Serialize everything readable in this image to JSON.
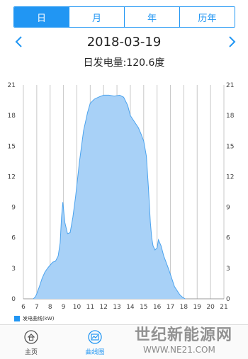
{
  "tabs": [
    {
      "label": "日",
      "active": true
    },
    {
      "label": "月",
      "active": false
    },
    {
      "label": "年",
      "active": false
    },
    {
      "label": "历年",
      "active": false
    }
  ],
  "date": "2018-03-19",
  "daily_generation": "日发电量:120.6度",
  "chart_data": {
    "type": "area",
    "xlabel": "",
    "ylabel": "",
    "xlim": [
      6,
      21
    ],
    "ylim": [
      0,
      21
    ],
    "x_ticks": [
      6,
      7,
      8,
      9,
      10,
      11,
      12,
      13,
      14,
      15,
      16,
      17,
      18,
      19,
      20,
      21
    ],
    "y_ticks": [
      0,
      3,
      6,
      9,
      12,
      15,
      18,
      21
    ],
    "grid": "vertical",
    "legend_position": "bottom-left",
    "series": [
      {
        "name": "发电曲线(kW)",
        "x": [
          6.75,
          6.9,
          7.0,
          7.2,
          7.4,
          7.6,
          7.8,
          8.0,
          8.2,
          8.4,
          8.6,
          8.75,
          8.85,
          8.95,
          9.1,
          9.3,
          9.5,
          9.7,
          9.9,
          10.2,
          10.5,
          10.8,
          11.0,
          11.3,
          11.6,
          12.0,
          12.4,
          12.8,
          13.2,
          13.5,
          13.8,
          14.0,
          14.2,
          14.4,
          14.6,
          14.8,
          15.0,
          15.2,
          15.35,
          15.5,
          15.6,
          15.7,
          15.85,
          16.0,
          16.1,
          16.3,
          16.5,
          16.7,
          16.9,
          17.1,
          17.3,
          17.5,
          17.7,
          17.9,
          18.1
        ],
        "values": [
          0,
          0.2,
          0.5,
          1.2,
          2.0,
          2.6,
          3.0,
          3.3,
          3.6,
          3.7,
          4.2,
          5.5,
          8.0,
          9.5,
          7.5,
          6.4,
          6.5,
          8.0,
          10.0,
          13.5,
          16.5,
          18.3,
          19.2,
          19.6,
          19.8,
          20.0,
          20.0,
          19.9,
          20.0,
          19.8,
          19.0,
          18.0,
          17.6,
          17.2,
          16.8,
          16.2,
          15.5,
          14.0,
          11.0,
          7.5,
          6.0,
          5.2,
          4.8,
          5.0,
          5.8,
          5.2,
          4.2,
          3.5,
          2.8,
          2.0,
          1.2,
          0.8,
          0.4,
          0.15,
          0
        ]
      }
    ]
  },
  "legend_label": "发电曲线(kW)",
  "bottom_nav": [
    {
      "label": "主页",
      "icon": "home-icon"
    },
    {
      "label": "曲线图",
      "icon": "curve-chart-icon"
    },
    {
      "label": "",
      "icon": ""
    },
    {
      "label": "",
      "icon": ""
    }
  ],
  "watermark": "世纪新能源网",
  "watermark_url": "WWW.NE21.COM",
  "colors": {
    "accent": "#2196f3",
    "area_fill": "#a8d1f7",
    "area_line": "#4ba3ee"
  }
}
